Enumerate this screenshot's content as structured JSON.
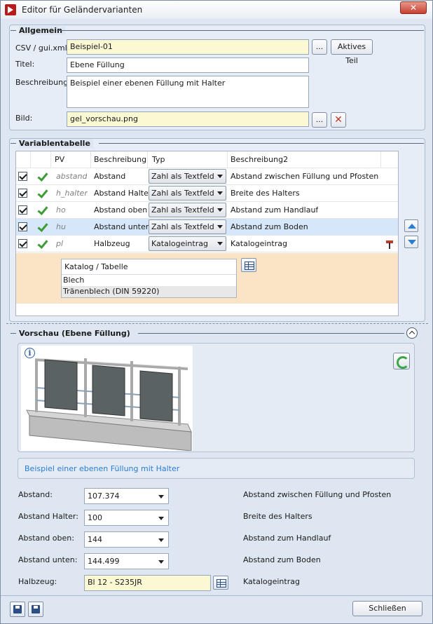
{
  "window": {
    "title": "Editor für Geländervarianten",
    "close_label": "✕"
  },
  "allgemein": {
    "section_title": "Allgemein",
    "csv_label": "CSV / gui.xml:",
    "csv_value": "Beispiel-01",
    "browse_label": "...",
    "aktives_teil_label": "Aktives Teil",
    "titel_label": "Titel:",
    "titel_value": "Ebene Füllung",
    "beschreibung_label": "Beschreibung:",
    "beschreibung_value": "Beispiel einer ebenen Füllung mit Halter",
    "bild_label": "Bild:",
    "bild_value": "gel_vorschau.png",
    "bild_browse_label": "..."
  },
  "variablentabelle": {
    "section_title": "Variablentabelle",
    "columns": [
      "PV",
      "Beschreibung",
      "Typ",
      "Beschreibung2"
    ],
    "rows": [
      {
        "pv": "abstand",
        "beschreibung": "Abstand",
        "typ": "Zahl als Textfeld",
        "beschreibung2": "Abstand zwischen Füllung und Pfosten"
      },
      {
        "pv": "h_halter",
        "beschreibung": "Abstand Halter",
        "typ": "Zahl als Textfeld",
        "beschreibung2": "Breite des Halters"
      },
      {
        "pv": "ho",
        "beschreibung": "Abstand oben",
        "typ": "Zahl als Textfeld",
        "beschreibung2": "Abstand zum Handlauf"
      },
      {
        "pv": "hu",
        "beschreibung": "Abstand unten",
        "typ": "Zahl als Textfeld",
        "beschreibung2": "Abstand zum Boden"
      },
      {
        "pv": "pl",
        "beschreibung": "Halbzeug",
        "typ": "Katalogeintrag",
        "beschreibung2": "Katalogeintrag"
      }
    ],
    "katalog": {
      "header": "Katalog / Tabelle",
      "items": [
        "Blech",
        "Tränenblech (DIN 59220)"
      ]
    }
  },
  "vorschau": {
    "section_title": "Vorschau (Ebene Füllung)",
    "info_label": "i",
    "description": "Beispiel einer ebenen Füllung mit Halter"
  },
  "parameters": [
    {
      "label": "Abstand:",
      "value": "107.374",
      "desc": "Abstand zwischen Füllung und Pfosten"
    },
    {
      "label": "Abstand Halter:",
      "value": "100",
      "desc": "Breite des Halters"
    },
    {
      "label": "Abstand oben:",
      "value": "144",
      "desc": "Abstand zum Handlauf"
    },
    {
      "label": "Abstand unten:",
      "value": "144.499",
      "desc": "Abstand zum Boden"
    }
  ],
  "halbzeug": {
    "label": "Halbzeug:",
    "value": "Bl 12 - S235JR",
    "desc": "Katalogeintrag"
  },
  "footer": {
    "close_button": "Schließen"
  }
}
